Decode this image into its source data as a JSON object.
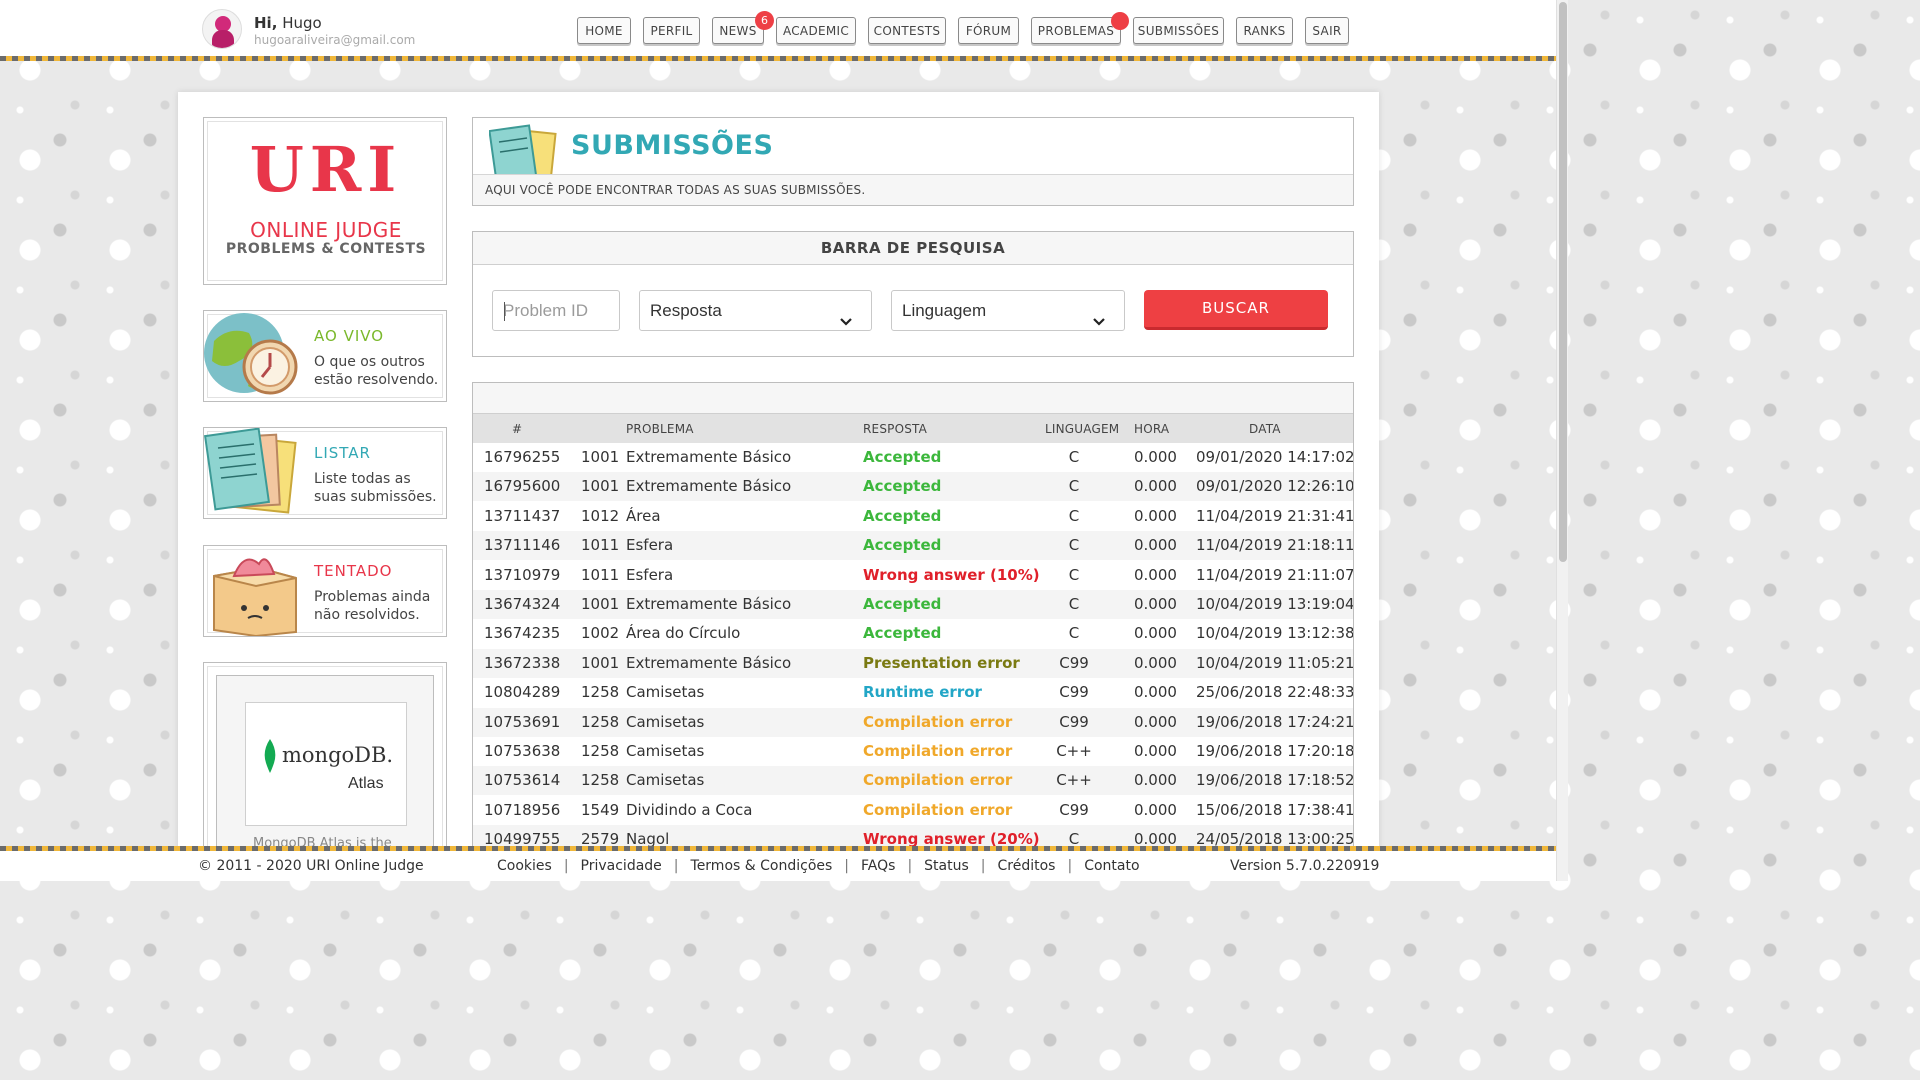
{
  "user": {
    "greeting": "Hi,",
    "name": "Hugo",
    "email": "hugoaraliveira@gmail.com"
  },
  "nav": [
    {
      "label": "HOME",
      "badge": ""
    },
    {
      "label": "PERFIL",
      "badge": ""
    },
    {
      "label": "NEWS",
      "badge": "6"
    },
    {
      "label": "ACADEMIC",
      "badge": ""
    },
    {
      "label": "CONTESTS",
      "badge": ""
    },
    {
      "label": "FÓRUM",
      "badge": ""
    },
    {
      "label": "PROBLEMAS",
      "badge": ""
    },
    {
      "label": "SUBMISSÕES",
      "badge": ""
    },
    {
      "label": "RANKS",
      "badge": ""
    },
    {
      "label": "SAIR",
      "badge": ""
    }
  ],
  "logo": {
    "line1": "URI",
    "line2": "ONLINE JUDGE",
    "line3": "PROBLEMS & CONTESTS"
  },
  "sidebar": [
    {
      "title": "AO VIVO",
      "desc": "O que os outros estão resolvendo.",
      "color": "#7ab82b",
      "icon": "globe-clock-icon"
    },
    {
      "title": "LISTAR",
      "desc": "Liste todas as suas submissões.",
      "color": "#32a8b4",
      "icon": "papers-icon"
    },
    {
      "title": "TENTADO",
      "desc": "Problemas ainda não resolvidos.",
      "color": "#e8364a",
      "icon": "box-fire-icon"
    }
  ],
  "sponsor": {
    "name": "mongoDB.",
    "product": "Atlas",
    "caption": "MongoDB Atlas is the"
  },
  "header": {
    "title": "SUBMISSÕES",
    "subtitle": "AQUI VOCÊ PODE ENCONTRAR TODAS AS SUAS SUBMISSÕES."
  },
  "search": {
    "title": "BARRA DE PESQUISA",
    "problem_placeholder": "Problem ID",
    "answer_select": "Resposta",
    "language_select": "Linguagem",
    "button": "BUSCAR"
  },
  "colors": {
    "Accepted": "#3cb73c",
    "Wrong": "#e0202a",
    "Presentation": "#7a7a12",
    "Runtime": "#22a6c6",
    "Compilation": "#f0a82a"
  },
  "table": {
    "headers": {
      "id": "#",
      "problem": "PROBLEMA",
      "answer": "RESPOSTA",
      "language": "LINGUAGEM",
      "time": "HORA",
      "date": "DATA"
    },
    "rows": [
      {
        "id": "16796255",
        "pid": "1001",
        "name": "Extremamente Básico",
        "answer": "Accepted",
        "kind": "Accepted",
        "lang": "C",
        "time": "0.000",
        "date": "09/01/2020 14:17:02"
      },
      {
        "id": "16795600",
        "pid": "1001",
        "name": "Extremamente Básico",
        "answer": "Accepted",
        "kind": "Accepted",
        "lang": "C",
        "time": "0.000",
        "date": "09/01/2020 12:26:10"
      },
      {
        "id": "13711437",
        "pid": "1012",
        "name": "Área",
        "answer": "Accepted",
        "kind": "Accepted",
        "lang": "C",
        "time": "0.000",
        "date": "11/04/2019 21:31:41"
      },
      {
        "id": "13711146",
        "pid": "1011",
        "name": "Esfera",
        "answer": "Accepted",
        "kind": "Accepted",
        "lang": "C",
        "time": "0.000",
        "date": "11/04/2019 21:18:11"
      },
      {
        "id": "13710979",
        "pid": "1011",
        "name": "Esfera",
        "answer": "Wrong answer (10%)",
        "kind": "Wrong",
        "lang": "C",
        "time": "0.000",
        "date": "11/04/2019 21:11:07"
      },
      {
        "id": "13674324",
        "pid": "1001",
        "name": "Extremamente Básico",
        "answer": "Accepted",
        "kind": "Accepted",
        "lang": "C",
        "time": "0.000",
        "date": "10/04/2019 13:19:04"
      },
      {
        "id": "13674235",
        "pid": "1002",
        "name": "Área do Círculo",
        "answer": "Accepted",
        "kind": "Accepted",
        "lang": "C",
        "time": "0.000",
        "date": "10/04/2019 13:12:38"
      },
      {
        "id": "13672338",
        "pid": "1001",
        "name": "Extremamente Básico",
        "answer": "Presentation error",
        "kind": "Presentation",
        "lang": "C99",
        "time": "0.000",
        "date": "10/04/2019 11:05:21"
      },
      {
        "id": "10804289",
        "pid": "1258",
        "name": "Camisetas",
        "answer": "Runtime error",
        "kind": "Runtime",
        "lang": "C99",
        "time": "0.000",
        "date": "25/06/2018 22:48:33"
      },
      {
        "id": "10753691",
        "pid": "1258",
        "name": "Camisetas",
        "answer": "Compilation error",
        "kind": "Compilation",
        "lang": "C99",
        "time": "0.000",
        "date": "19/06/2018 17:24:21"
      },
      {
        "id": "10753638",
        "pid": "1258",
        "name": "Camisetas",
        "answer": "Compilation error",
        "kind": "Compilation",
        "lang": "C++",
        "time": "0.000",
        "date": "19/06/2018 17:20:18"
      },
      {
        "id": "10753614",
        "pid": "1258",
        "name": "Camisetas",
        "answer": "Compilation error",
        "kind": "Compilation",
        "lang": "C++",
        "time": "0.000",
        "date": "19/06/2018 17:18:52"
      },
      {
        "id": "10718956",
        "pid": "1549",
        "name": "Dividindo a Coca",
        "answer": "Compilation error",
        "kind": "Compilation",
        "lang": "C99",
        "time": "0.000",
        "date": "15/06/2018 17:38:41"
      },
      {
        "id": "10499755",
        "pid": "2579",
        "name": "Nagol",
        "answer": "Wrong answer (20%)",
        "kind": "Wrong",
        "lang": "C",
        "time": "0.000",
        "date": "24/05/2018 13:00:25"
      }
    ]
  },
  "footer": {
    "copyright": "© 2011 - 2020 URI Online Judge",
    "links": [
      "Cookies",
      "Privacidade",
      "Termos & Condições",
      "FAQs",
      "Status",
      "Créditos",
      "Contato"
    ],
    "version": "Version 5.7.0.220919"
  }
}
